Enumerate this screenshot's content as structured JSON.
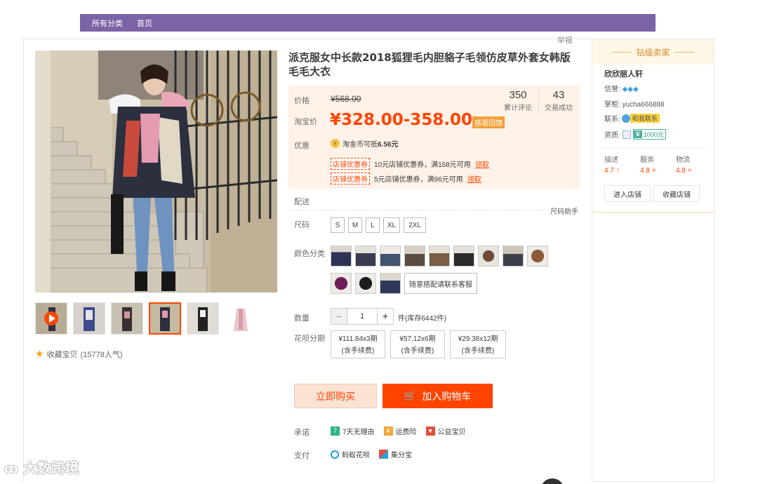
{
  "nav": {
    "items": [
      "所有分类",
      "首页"
    ]
  },
  "report_label": "举报",
  "product": {
    "title": "派克服女中长款2018狐狸毛内胆貉子毛领仿皮草外套女韩版毛毛大衣",
    "price_label": "价格",
    "old_price": "¥568.00",
    "taobao_price_label": "淘宝价",
    "price": "¥328.00-358.00",
    "thanks_tag": "感恩回馈",
    "reviews_count": "350",
    "reviews_label": "累计评论",
    "trades_count": "43",
    "trades_label": "交易成功",
    "discount_label": "优惠",
    "coin_text": "淘金币可抵",
    "coin_value": "6.56元",
    "coupons": [
      {
        "tag": "店铺优惠券",
        "text": "10元店铺优惠券，满168元可用",
        "link": "领取"
      },
      {
        "tag": "店铺优惠券",
        "text": "5元店铺优惠券，满96元可用",
        "link": "领取"
      }
    ],
    "delivery_label": "配送",
    "size_helper": "尺码助手",
    "size_label": "尺码",
    "sizes": [
      "S",
      "M",
      "L",
      "XL",
      "2XL"
    ],
    "color_label": "颜色分类",
    "color_text_option": "随意搭配请联系客服",
    "qty_label": "数量",
    "qty_minus": "−",
    "qty_value": "1",
    "qty_plus": "+",
    "stock_text": "件(库存6442件)",
    "installment_label": "花呗分期",
    "installments": [
      {
        "line1": "¥111.84x3期",
        "line2": "(含手续费)"
      },
      {
        "line1": "¥57.12x6期",
        "line2": "(含手续费)"
      },
      {
        "line1": "¥29.38x12期",
        "line2": "(含手续费)"
      }
    ],
    "buy_now": "立即购买",
    "add_cart": "加入购物车",
    "promise_label": "承诺",
    "promises": [
      "7天无理由",
      "运费险",
      "公益宝贝"
    ],
    "pay_label": "支付",
    "payments": [
      "蚂蚁花呗",
      "集分宝"
    ]
  },
  "gallery": {
    "favorite_label": "收藏宝贝",
    "favorite_count": "(15778人气)"
  },
  "seller": {
    "header": "钻级卖家",
    "name": "欣欣丽人轩",
    "credit_label": "信誉:",
    "keeper_label": "掌柜:",
    "keeper_value": "yucha666888",
    "contact_label": "联系:",
    "contact_badge": "和我联系",
    "qual_label": "资质:",
    "qual_value": "1000元",
    "scores": [
      {
        "label": "描述",
        "value": "4.7",
        "trend": "↑"
      },
      {
        "label": "服务",
        "value": "4.8",
        "trend": "="
      },
      {
        "label": "物流",
        "value": "4.8",
        "trend": "="
      }
    ],
    "enter_shop": "进入店铺",
    "fav_shop": "收藏店铺"
  },
  "watermark": "大数跨境",
  "colors": {
    "accent": "#ff4400",
    "nav": "#7b64a6",
    "price_bg": "#fff2e8"
  }
}
